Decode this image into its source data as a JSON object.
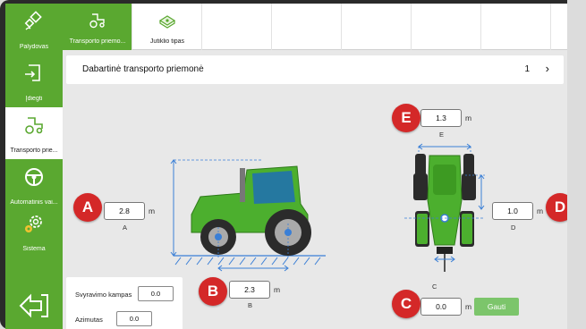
{
  "sidebar": {
    "items": [
      {
        "label": "Palydovas",
        "icon": "satellite-icon"
      },
      {
        "label": "Įdiegti",
        "icon": "install-icon"
      },
      {
        "label": "Transporto prie...",
        "icon": "tractor-icon"
      },
      {
        "label": "Automatinis vai...",
        "icon": "steering-wheel-icon"
      },
      {
        "label": "Sistema",
        "icon": "gear-icon"
      }
    ],
    "back_icon": "back-arrow-icon"
  },
  "tabs": [
    {
      "label": "Transporto priemo...",
      "icon": "tractor-icon"
    },
    {
      "label": "Jutiklio tipas",
      "icon": "sensor-icon"
    }
  ],
  "vehicle": {
    "title": "Dabartinė transporto priemonė",
    "number": "1"
  },
  "measurements": {
    "A": {
      "badge": "A",
      "value": "2.8",
      "unit": "m",
      "caption": "A"
    },
    "B": {
      "badge": "B",
      "value": "2.3",
      "unit": "m",
      "caption": "B"
    },
    "C": {
      "badge": "C",
      "value": "0.0",
      "unit": "m",
      "caption": "C"
    },
    "D": {
      "badge": "D",
      "value": "1.0",
      "unit": "m",
      "caption": "D"
    },
    "E": {
      "badge": "E",
      "value": "1.3",
      "unit": "m",
      "caption": "E"
    }
  },
  "gauti_label": "Gauti",
  "angles": {
    "roll_label": "Svyravimo kampas",
    "roll_value": "0.0",
    "azimuth_label": "Azimutas",
    "azimuth_value": "0.0"
  },
  "colors": {
    "green": "#5aa830",
    "badge_red": "#d42828",
    "gauti_green": "#7cc56b",
    "dimension_blue": "#3a7fd6"
  }
}
